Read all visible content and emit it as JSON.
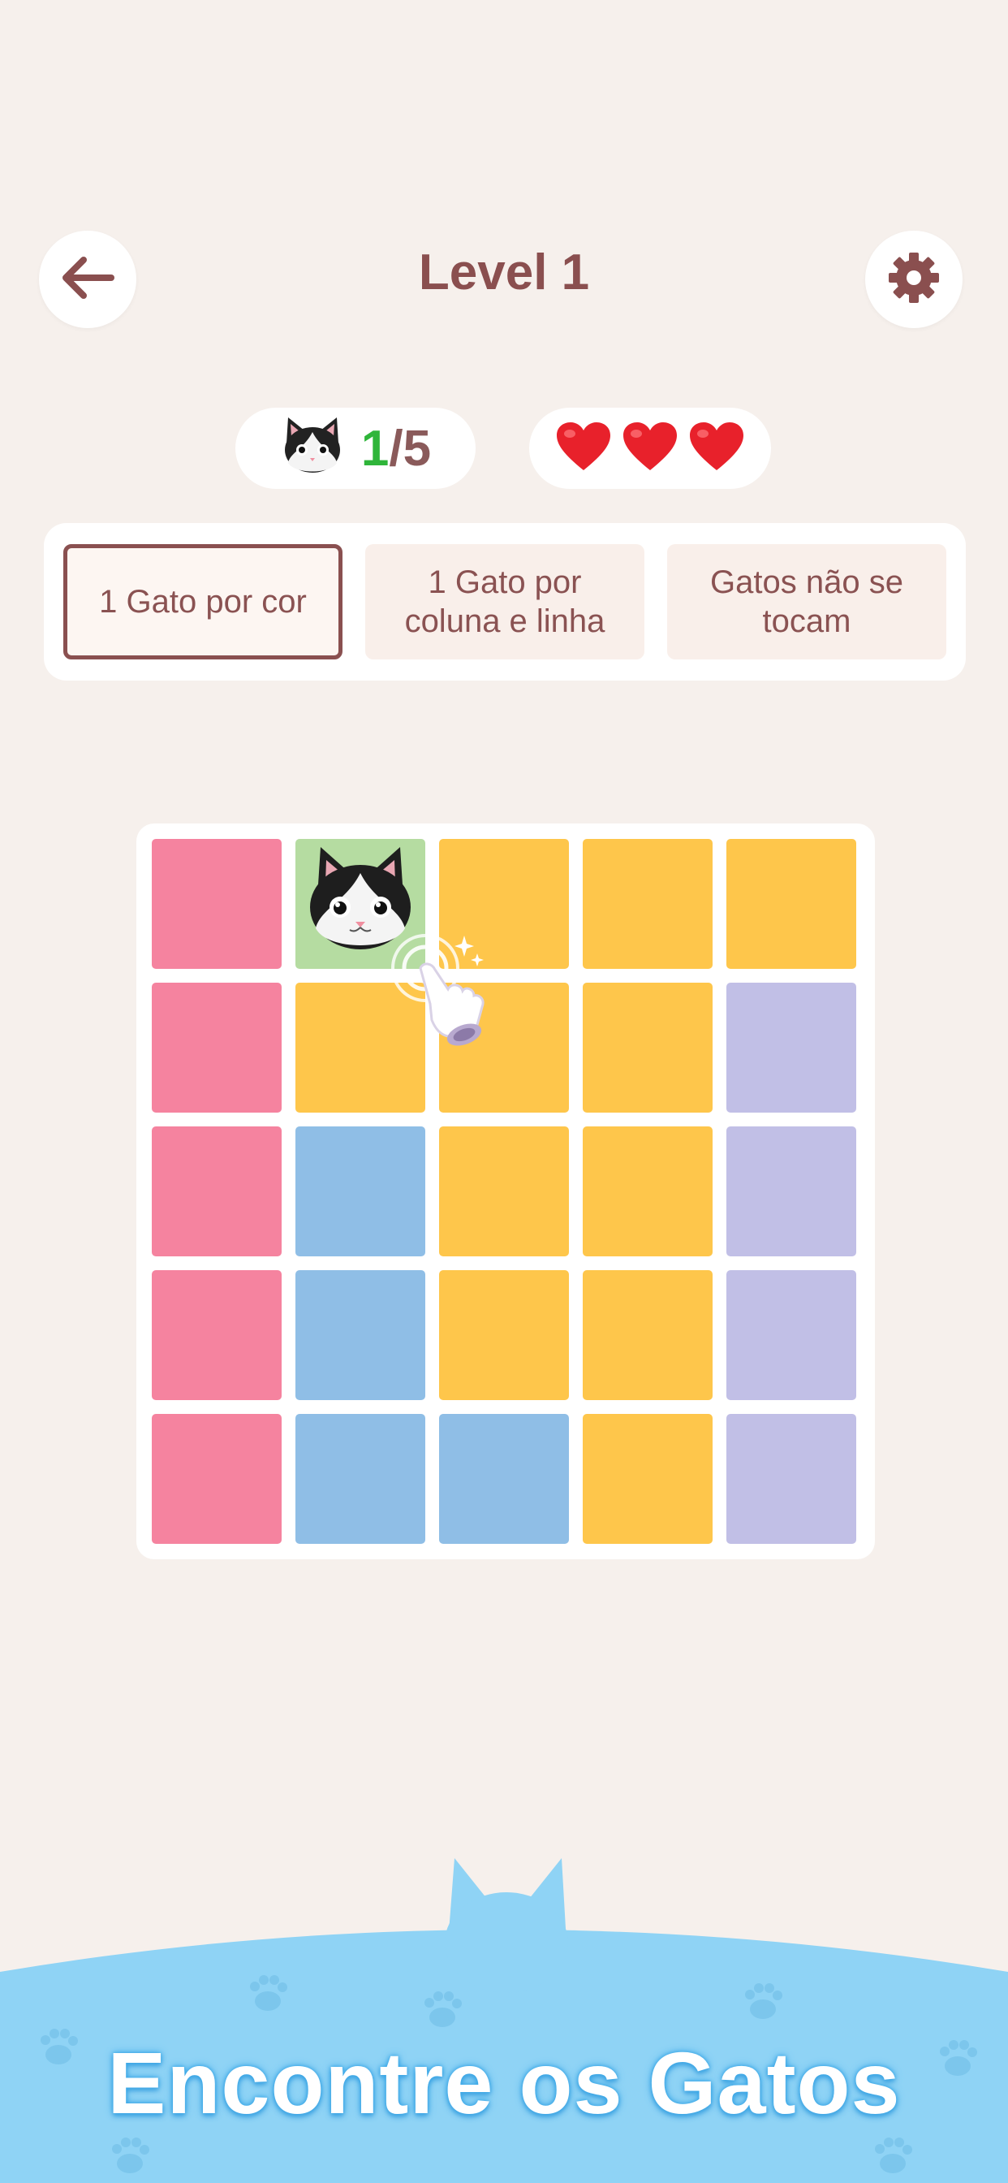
{
  "header": {
    "title": "Level 1"
  },
  "status": {
    "progress_found": "1",
    "progress_total": "/5",
    "lives": 3
  },
  "rules": [
    {
      "label": "1 Gato por cor",
      "active": true
    },
    {
      "label": "1 Gato por\ncoluna e linha",
      "active": false
    },
    {
      "label": "Gatos não se\ntocam",
      "active": false
    }
  ],
  "colors": {
    "pink": "#f5839f",
    "yellow": "#fec64b",
    "blue": "#8fbee6",
    "lavender": "#c1bfe6",
    "found": "#b5dca1",
    "accent": "#8a4f4f"
  },
  "board": {
    "size": 5,
    "rows": [
      [
        "pink",
        "found",
        "yellow",
        "yellow",
        "yellow"
      ],
      [
        "pink",
        "yellow",
        "yellow",
        "yellow",
        "lavender"
      ],
      [
        "pink",
        "blue",
        "yellow",
        "yellow",
        "lavender"
      ],
      [
        "pink",
        "blue",
        "yellow",
        "yellow",
        "lavender"
      ],
      [
        "pink",
        "blue",
        "blue",
        "yellow",
        "lavender"
      ]
    ],
    "cat_cell": {
      "row": 0,
      "col": 1
    }
  },
  "footer": {
    "title": "Encontre os Gatos"
  }
}
